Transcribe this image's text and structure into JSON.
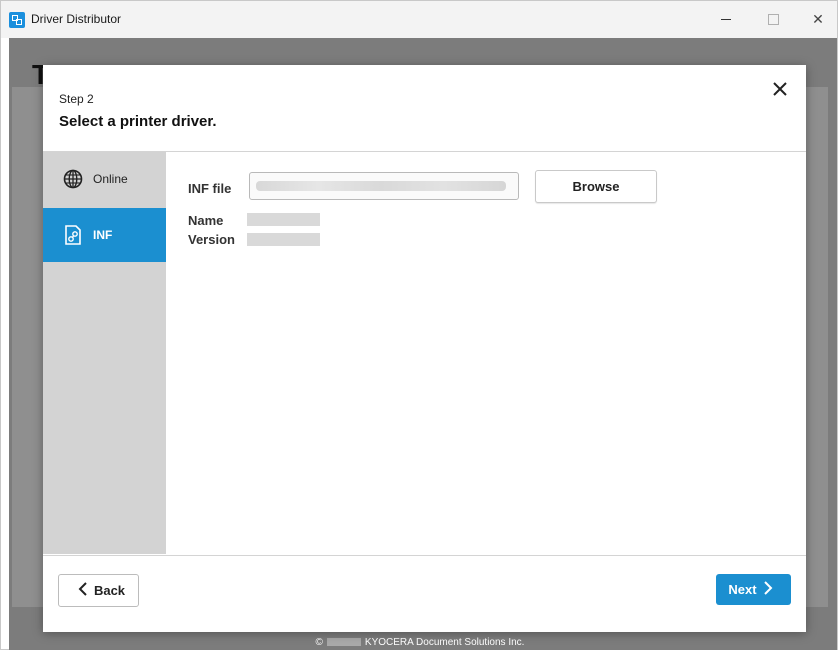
{
  "window": {
    "title": "Driver Distributor",
    "controls": [
      "minimize",
      "maximize",
      "close"
    ]
  },
  "background": {
    "heading": "T",
    "footer": {
      "symbol": "©",
      "company": "KYOCERA Document Solutions Inc."
    }
  },
  "dialog": {
    "step_label": "Step 2",
    "title": "Select a printer driver.",
    "close_icon": "close-icon",
    "sidebar": {
      "items": [
        {
          "label": "Online",
          "icon": "globe-icon",
          "selected": false
        },
        {
          "label": "INF",
          "icon": "inf-file-icon",
          "selected": true
        }
      ]
    },
    "content": {
      "inf_file_label": "INF file",
      "inf_file_value": "",
      "browse_label": "Browse",
      "name_label": "Name",
      "version_label": "Version"
    },
    "footer": {
      "back_label": "Back",
      "next_label": "Next"
    }
  },
  "colors": {
    "accent": "#1b8fd0",
    "sidebar_bg": "#d3d3d3",
    "overlay": "#7c7c7c"
  }
}
